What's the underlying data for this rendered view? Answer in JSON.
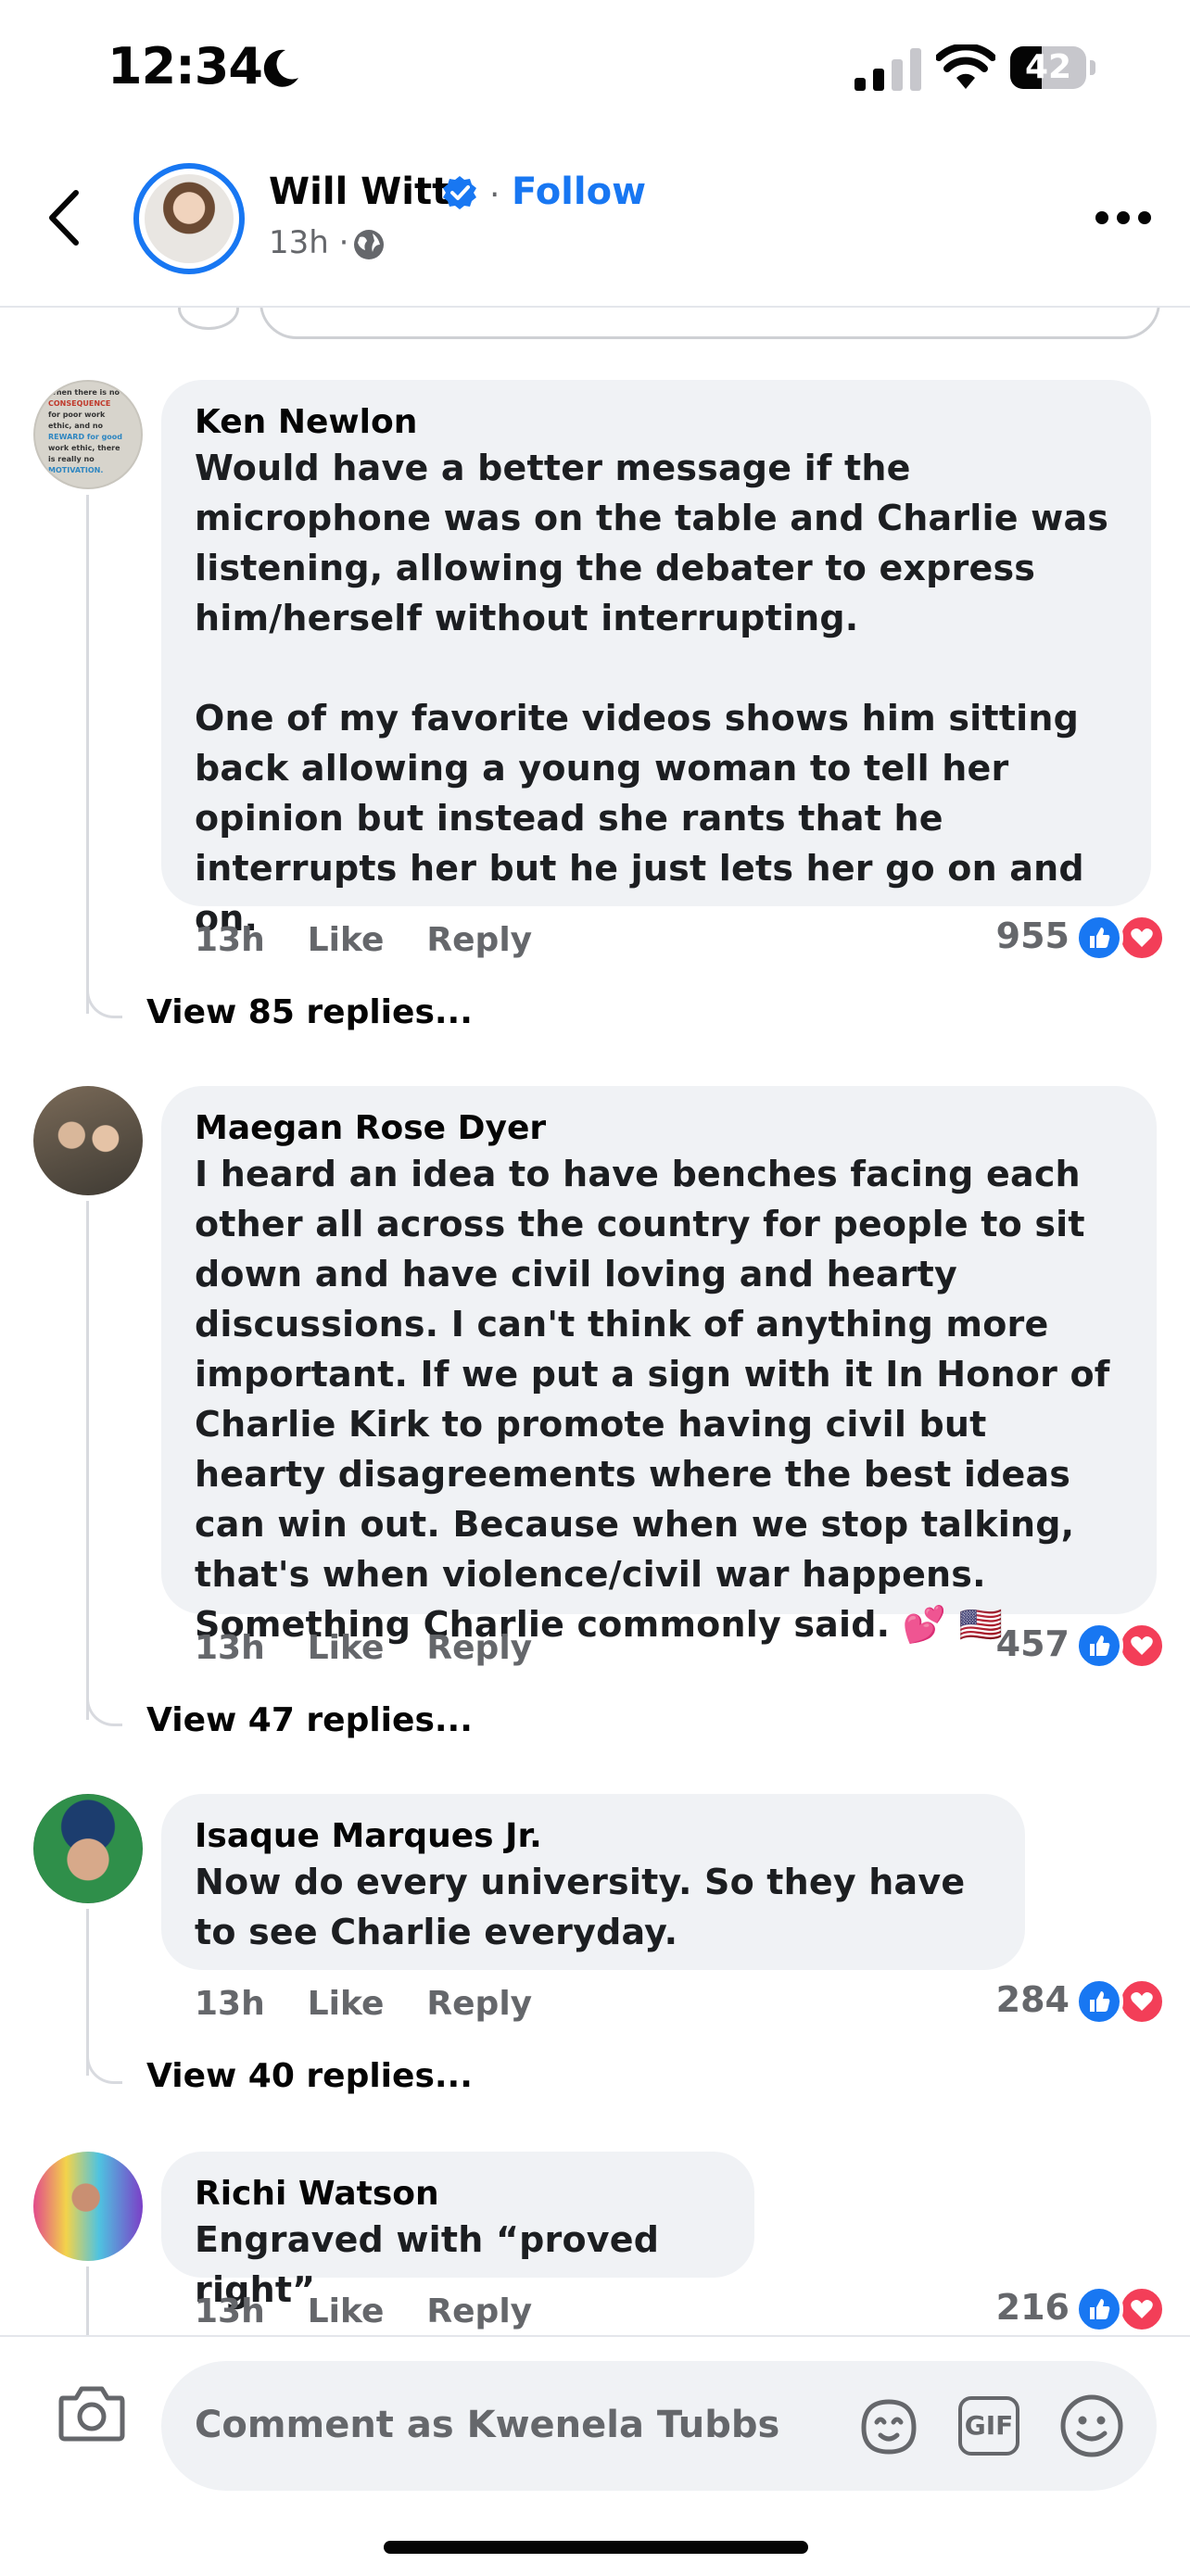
{
  "status_bar": {
    "time": "12:34",
    "battery": "42",
    "battery_level": 0.42
  },
  "header": {
    "name": "Will Witt",
    "separator": "·",
    "follow_label": "Follow",
    "meta": "13h ·"
  },
  "comments": [
    {
      "author": "Ken Newlon",
      "text": "Would have a better message if the microphone was on the table and Charlie was listening, allowing the debater to express him/herself without interrupting.\n\nOne of my favorite videos shows him sitting back allowing a young woman to tell her opinion but instead she rants that he interrupts her but he just lets her go on and on.",
      "time": "13h",
      "like_label": "Like",
      "reply_label": "Reply",
      "reactions": "955",
      "view_replies": "View 85 replies...",
      "avatar_text": [
        "When there is no",
        "CONSEQUENCE",
        "for poor work",
        "ethic, and no",
        "REWARD for good",
        "work ethic, there",
        "is really no",
        "MOTIVATION."
      ]
    },
    {
      "author": "Maegan Rose Dyer",
      "text": "I heard an idea to have benches facing each other all across the country for people to sit down and have civil loving and hearty discussions. I can't think of anything more important. If we put a sign with it In Honor of Charlie Kirk to promote having civil but hearty disagreements where the best ideas can win out. Because when we stop talking, that's when violence/civil war happens. Something Charlie commonly said. 💕 🇺🇸",
      "time": "13h",
      "like_label": "Like",
      "reply_label": "Reply",
      "reactions": "457",
      "view_replies": "View 47 replies..."
    },
    {
      "author": "Isaque Marques Jr.",
      "text": "Now do every university. So they have to see Charlie everyday.",
      "time": "13h",
      "like_label": "Like",
      "reply_label": "Reply",
      "reactions": "284",
      "view_replies": "View 40 replies..."
    },
    {
      "author": "Richi Watson",
      "text": "Engraved with “proved right”",
      "time": "13h",
      "like_label": "Like",
      "reply_label": "Reply",
      "reactions": "216"
    }
  ],
  "comment_bar": {
    "placeholder": "Comment as Kwenela Tubbs",
    "gif_label": "GIF"
  },
  "colors": {
    "accent": "#1877f2",
    "love": "#f33e58",
    "bubble": "#f0f2f5",
    "secondary_text": "#65676b"
  },
  "icons": [
    "moon-icon",
    "signal-icon",
    "wifi-icon",
    "battery-icon",
    "back-chevron-icon",
    "verified-badge-icon",
    "globe-icon",
    "more-icon",
    "like-reaction-icon",
    "love-reaction-icon",
    "camera-icon",
    "sticker-icon",
    "gif-icon",
    "emoji-icon"
  ]
}
